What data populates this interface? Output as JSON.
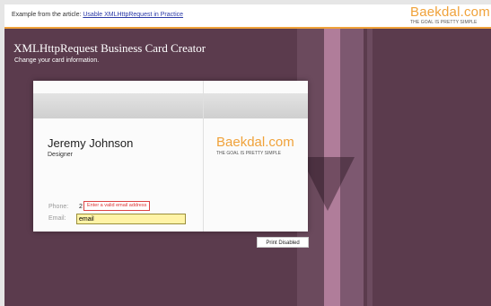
{
  "header": {
    "example_prefix": "Example from the article:",
    "article_link": "Usable XMLHttpRequest in Practice",
    "brand": "Baekdal.com",
    "tagline": "THE GOAL IS PRETTY SIMPLE"
  },
  "page": {
    "title": "XMLHttpRequest Business Card Creator",
    "subtitle": "Change your card information."
  },
  "card": {
    "name": "Jeremy Johnson",
    "job_title": "Designer",
    "brand": "Baekdal.com",
    "tagline": "THE GOAL IS PRETTY SIMPLE",
    "phone_label": "Phone:",
    "phone_value": "2",
    "email_label": "Email:",
    "email_value": "email",
    "error_message": "Enter a valid email address"
  },
  "actions": {
    "print_label": "Print Disabled"
  },
  "colors": {
    "accent": "#f0a23a",
    "background": "#5b3b4d",
    "error": "#d33333",
    "input_highlight": "#fff3a6"
  }
}
